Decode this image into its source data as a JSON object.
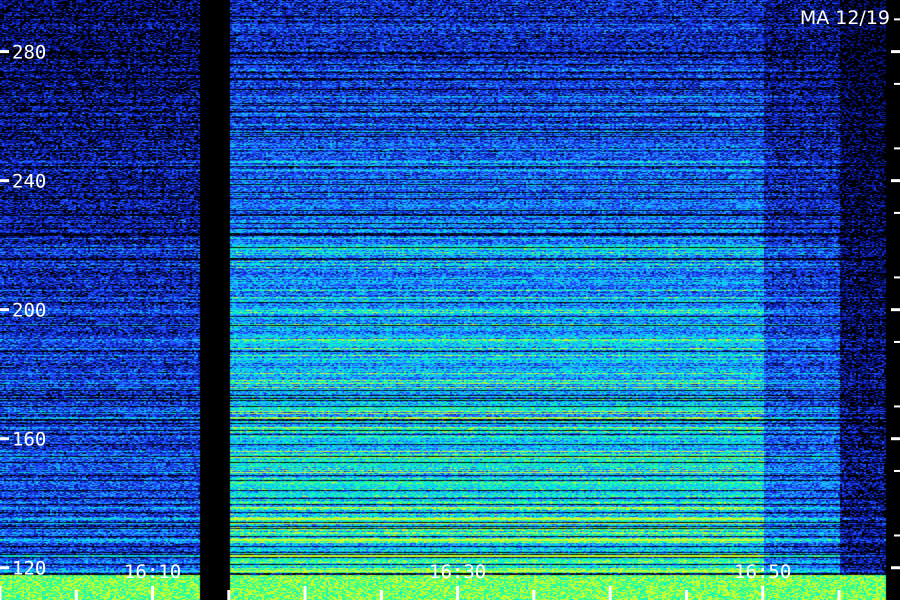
{
  "chart_data": {
    "type": "heatmap",
    "title": "MA 12/19",
    "xlabel": "",
    "ylabel": "",
    "y_ticks": [
      "280",
      "240",
      "200",
      "160",
      "120"
    ],
    "y_tick_values": [
      280,
      240,
      200,
      160,
      120
    ],
    "ylim": [
      110,
      296
    ],
    "x_ticks": [
      "16:10",
      "16:30",
      "16:50"
    ],
    "x_tick_minutes": [
      970,
      990,
      1010
    ],
    "xlim_minutes": [
      960,
      1019
    ],
    "grid": false,
    "colormap": [
      "#000000",
      "#0a1aa0",
      "#1e4cff",
      "#1fa8ff",
      "#00e8e0",
      "#30ff90",
      "#c8ff30"
    ],
    "segments": [
      {
        "start": "16:00",
        "end": "16:13",
        "level": "moderate"
      },
      {
        "start": "16:13",
        "end": "16:15",
        "level": "gap"
      },
      {
        "start": "16:15",
        "end": "16:50",
        "level": "strong"
      },
      {
        "start": "16:50",
        "end": "16:55",
        "level": "fading"
      },
      {
        "start": "16:55",
        "end": "16:58",
        "level": "weak"
      }
    ]
  }
}
